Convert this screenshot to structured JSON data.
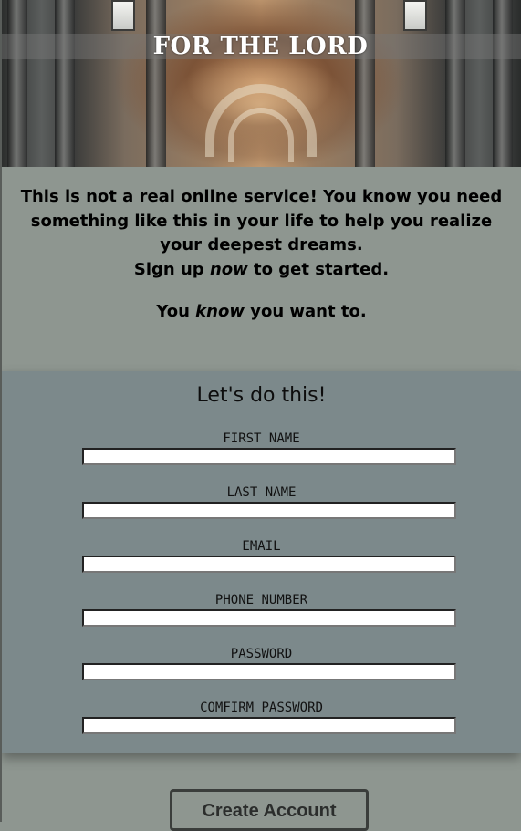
{
  "hero": {
    "title": "FOR THE LORD"
  },
  "intro": {
    "line1": "This is not a real online service! You know you need something like this in your life to help you realize your deepest dreams.",
    "line2_before": "Sign up ",
    "line2_em": "now",
    "line2_after": " to get started.",
    "line3_before": "You ",
    "line3_em": "know",
    "line3_after": " you want to."
  },
  "form": {
    "title": "Let's do this!",
    "fields": [
      {
        "label": "FIRST NAME",
        "value": ""
      },
      {
        "label": "LAST NAME",
        "value": ""
      },
      {
        "label": "EMAIL",
        "value": ""
      },
      {
        "label": "PHONE NUMBER",
        "value": ""
      },
      {
        "label": "PASSWORD",
        "value": ""
      },
      {
        "label": "COMFIRM PASSWORD",
        "value": ""
      }
    ]
  },
  "actions": {
    "create_account_label": "Create Account"
  },
  "colors": {
    "page_bg": "#8e9690",
    "form_bg": "#7c898b",
    "button_border": "#3a3d3b"
  }
}
